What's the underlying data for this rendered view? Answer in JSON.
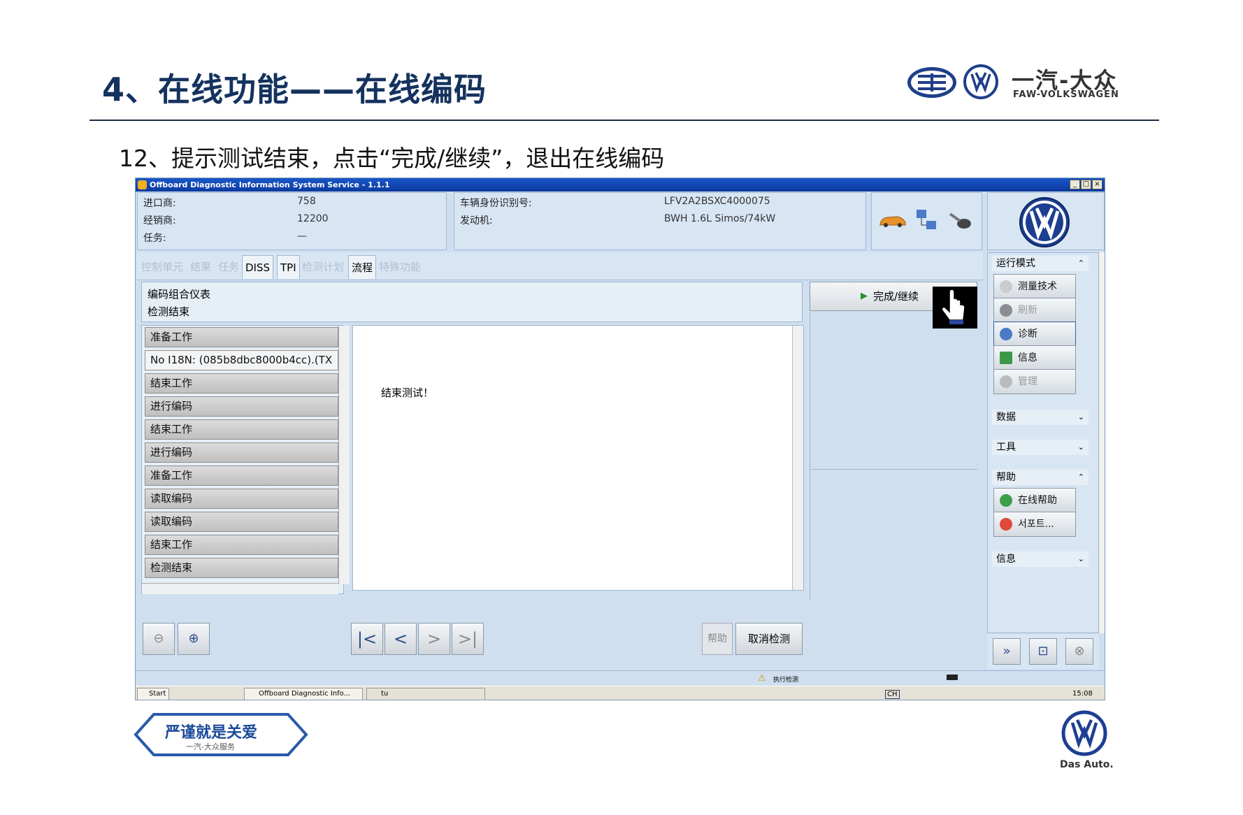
{
  "slide": {
    "title": "4、在线功能——在线编码",
    "subtitle": "12、提示测试结束，点击“完成/继续”，退出在线编码",
    "brand_cn": "一汽-大众",
    "brand_en": "FAW-VOLKSWAGEN",
    "footer_text": "严谨就是关爱",
    "footer_sub": "一汽-大众服务",
    "das_auto": "Das Auto."
  },
  "window": {
    "title": "Offboard Diagnostic Information System Service - 1.1.1",
    "controls": [
      "_",
      "□",
      "×"
    ]
  },
  "header": {
    "importer_label": "进口商:",
    "importer_value": "758",
    "dealer_label": "经销商:",
    "dealer_value": "12200",
    "task_label": "任务:",
    "task_value": "—",
    "vin_label": "车辆身份识别号:",
    "vin_value": "LFV2A2BSXC4000075",
    "engine_label": "发动机:",
    "engine_value": "BWH 1.6L Simos/74kW"
  },
  "tabs": [
    "控制单元",
    "结果",
    "任务",
    "DISS",
    "TPI",
    "检测计划",
    "流程",
    "特殊功能"
  ],
  "path": {
    "line1": "编码组合仪表",
    "line2": "检测结束"
  },
  "done_button": "完成/继续",
  "steps": [
    "准备工作",
    "No I18N: (085b8dbc8000b4cc).(TX",
    "结束工作",
    "进行编码",
    "结束工作",
    "进行编码",
    "准备工作",
    "读取编码",
    "读取编码",
    "结束工作",
    "检测结束"
  ],
  "content_text": "结束测试！",
  "bottom": {
    "help": "帮助",
    "cancel": "取消检测"
  },
  "sidebar": {
    "mode_section": "运行模式",
    "buttons": [
      {
        "label": "测量技术",
        "icon": "gauge-icon",
        "enabled": true
      },
      {
        "label": "刷新",
        "icon": "car-icon",
        "enabled": false
      },
      {
        "label": "诊断",
        "icon": "stethoscope-icon",
        "enabled": true
      },
      {
        "label": "信息",
        "icon": "books-icon",
        "enabled": true
      },
      {
        "label": "管理",
        "icon": "gear-icon",
        "enabled": false
      }
    ],
    "data_section": "数据",
    "tools_section": "工具",
    "help_section": "帮助",
    "help_buttons": [
      {
        "label": "在线帮助",
        "icon": "help-icon"
      },
      {
        "label": "서포트...",
        "icon": "lifebuoy-icon"
      }
    ],
    "info_section": "信息"
  },
  "status": {
    "text": "执行检测"
  },
  "taskbar": {
    "start": "Start",
    "task1": "Offboard Diagnostic Info...",
    "task2": "tu",
    "lang": "CH",
    "time": "15:08"
  },
  "colors": {
    "title": "#14325e",
    "window_bg": "#cfdff0",
    "titlebar": "#0b3a9e"
  }
}
